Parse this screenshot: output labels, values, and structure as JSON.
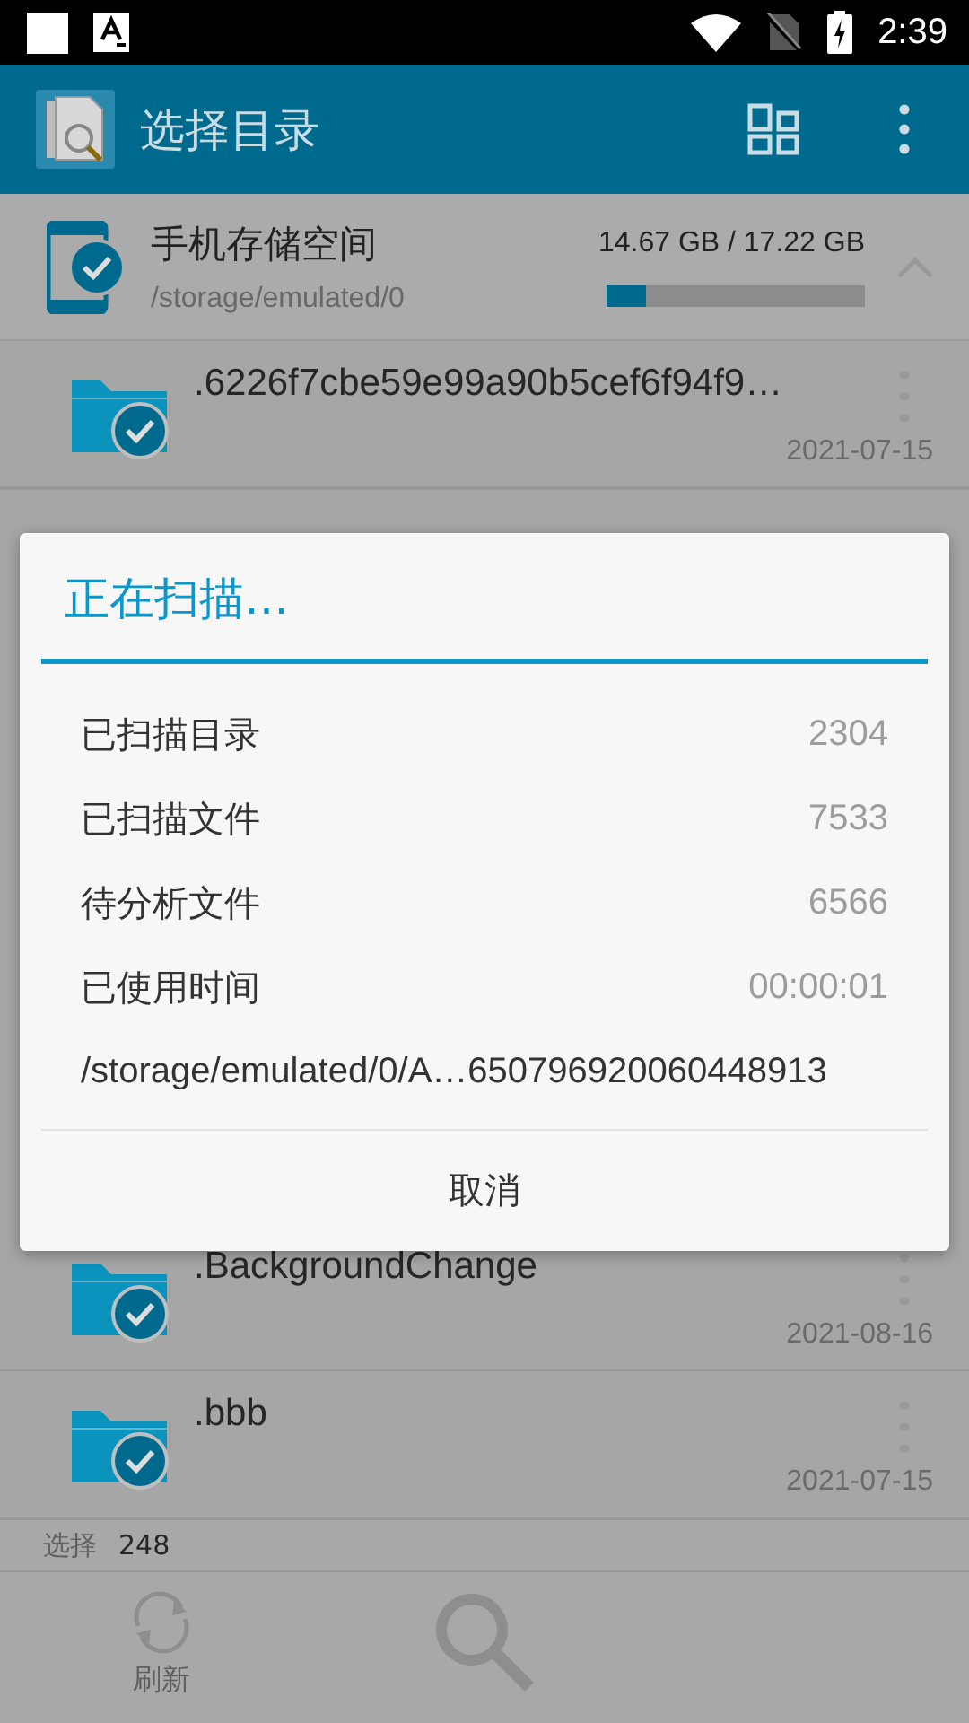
{
  "status_bar": {
    "time": "2:39"
  },
  "app_bar": {
    "title": "选择目录"
  },
  "storage": {
    "name": "手机存储空间",
    "path": "/storage/emulated/0",
    "usage": "14.67 GB / 17.22 GB",
    "level": 0.15,
    "expanded": true
  },
  "folders_top": [
    {
      "name": ".6226f7cbe59e99a90b5cef6f94f9…",
      "date": "2021-07-15",
      "checked": true
    }
  ],
  "folders_bottom": [
    {
      "name": ".BackgroundChange",
      "date": "2021-08-16",
      "checked": true
    },
    {
      "name": ".bbb",
      "date": "2021-07-15",
      "checked": true
    }
  ],
  "selection": {
    "label": "选择",
    "count": "248"
  },
  "bottom_bar": [
    {
      "kind": "refresh",
      "label": "刷新"
    },
    {
      "kind": "search"
    }
  ],
  "dialog": {
    "title": "正在扫描…",
    "rows": [
      {
        "label": "已扫描目录",
        "value": "2304"
      },
      {
        "label": "已扫描文件",
        "value": "7533"
      },
      {
        "label": "待分析文件",
        "value": "6566"
      },
      {
        "label": "已使用时间",
        "value": "00:00:01"
      }
    ],
    "path": "/storage/emulated/0/A…650796920060448913",
    "cancel": "取消"
  }
}
